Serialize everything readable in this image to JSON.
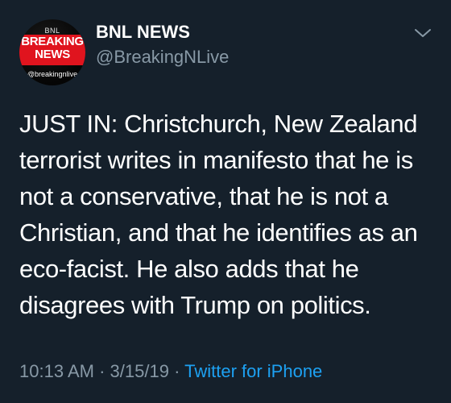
{
  "tweet": {
    "avatar": {
      "line_top": "BNL",
      "line_1": "BREAKING",
      "line_2": "NEWS",
      "line_handle": "@breakingnlive"
    },
    "display_name": "BNL NEWS",
    "handle": "@BreakingNLive",
    "menu_icon": "chevron-down-icon",
    "text": "JUST IN: Christchurch, New Zealand terrorist writes in manifesto that he is not a conservative, that he is not a Christian, and that he identifies as an eco-facist. He also adds that he disagrees with Trump on politics.",
    "time": "10:13 AM",
    "date": "3/15/19",
    "separator": "·",
    "source": "Twitter for iPhone"
  },
  "colors": {
    "background": "#15202b",
    "primary_text": "#ffffff",
    "secondary_text": "#8899a6",
    "link": "#1da1f2",
    "brand_red": "#e0141e"
  }
}
